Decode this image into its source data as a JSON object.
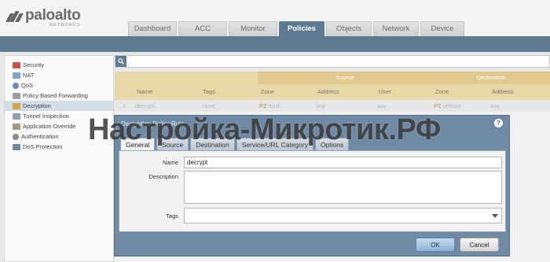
{
  "brand": {
    "name": "paloalto",
    "subtitle": "NETWORKS",
    "color": "#646464"
  },
  "main_tabs": [
    {
      "label": "Dashboard",
      "active": false
    },
    {
      "label": "ACC",
      "active": false
    },
    {
      "label": "Monitor",
      "active": false
    },
    {
      "label": "Policies",
      "active": true
    },
    {
      "label": "Objects",
      "active": false
    },
    {
      "label": "Network",
      "active": false
    },
    {
      "label": "Device",
      "active": false
    }
  ],
  "sidebar": {
    "items": [
      {
        "label": "Security",
        "icon": "shield-icon"
      },
      {
        "label": "NAT",
        "icon": "nat-icon"
      },
      {
        "label": "QoS",
        "icon": "qos-icon"
      },
      {
        "label": "Policy Based Forwarding",
        "icon": "forwarding-icon"
      },
      {
        "label": "Decryption",
        "icon": "lock-icon",
        "selected": true
      },
      {
        "label": "Tunnel Inspection",
        "icon": "tunnel-icon"
      },
      {
        "label": "Application Override",
        "icon": "app-override-icon"
      },
      {
        "label": "Authentication",
        "icon": "user-icon"
      },
      {
        "label": "DoS Protection",
        "icon": "dos-icon"
      }
    ]
  },
  "rules_table": {
    "group_headers": {
      "source": "Source",
      "destination": "Destination"
    },
    "columns": [
      "Name",
      "Tags",
      "Zone",
      "Address",
      "User",
      "Zone",
      "Address"
    ],
    "rows": [
      {
        "num": "1",
        "name": "decrypt",
        "tags": "none",
        "src_zone": "trust",
        "src_address": "any",
        "src_user": "any",
        "dst_zone": "untrust",
        "dst_address": "any",
        "zone_tag": "PZ"
      }
    ]
  },
  "dialog": {
    "title": "Decryption Policy Rule",
    "help": "?",
    "tabs": [
      {
        "label": "General",
        "active": true
      },
      {
        "label": "Source",
        "active": false
      },
      {
        "label": "Destination",
        "active": false
      },
      {
        "label": "Service/URL Category",
        "active": false
      },
      {
        "label": "Options",
        "active": false
      }
    ],
    "fields": {
      "name_label": "Name",
      "name_value": "decrypt",
      "description_label": "Description",
      "description_value": "",
      "tags_label": "Tags",
      "tags_value": ""
    },
    "ok_label": "OK",
    "cancel_label": "Cancel"
  },
  "watermark": "Настройка-Микротик.РФ",
  "colors": {
    "accent": "#5f7a93",
    "table_header": "#e6d8a7",
    "group_header": "#e0c98f",
    "dialog": "#6f8aa4"
  }
}
